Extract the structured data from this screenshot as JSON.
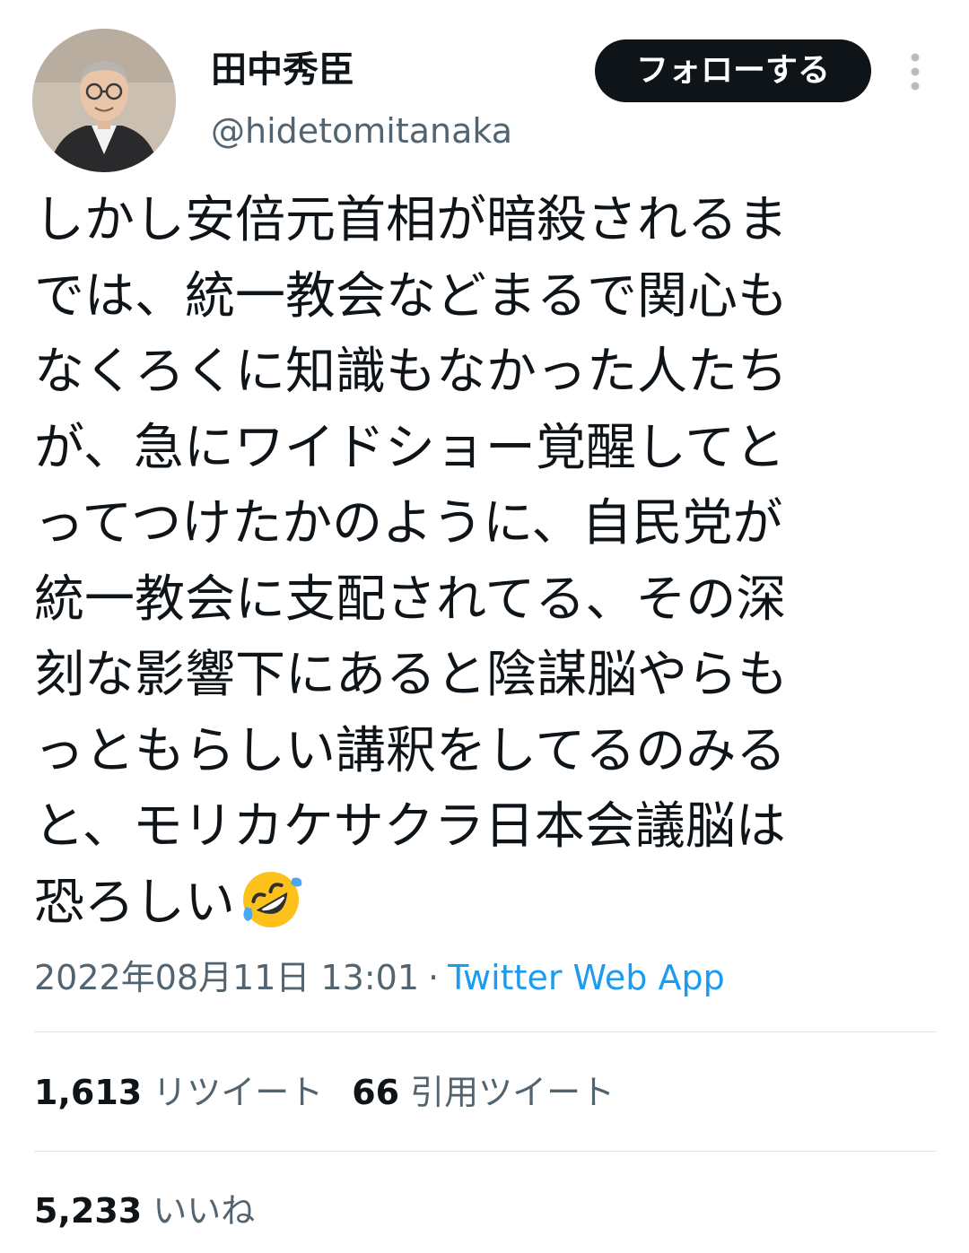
{
  "user": {
    "display_name": "田中秀臣",
    "handle": "@hidetomitanaka",
    "avatar_icon": "profile-photo"
  },
  "follow_button": {
    "label": "フォローする"
  },
  "more_menu": {
    "icon": "more-vertical-icon"
  },
  "tweet": {
    "lines": [
      "しかし安倍元首相が暗殺されるま",
      "では、統一教会などまるで関心も",
      "なくろくに知識もなかった人たち",
      "が、急にワイドショー覚醒してと",
      "ってつけたかのように、自民党が",
      "統一教会に支配されてる、その深",
      "刻な影響下にあると陰謀脳やらも",
      "っともらしい講釈をしてるのみる",
      "と、モリカケサクラ日本会議脳は",
      "恐ろしい"
    ],
    "emoji": "rolling-on-the-floor-laughing-emoji"
  },
  "meta": {
    "timestamp": "2022年08月11日 13:01",
    "separator": "·",
    "source": "Twitter Web App"
  },
  "stats": {
    "retweets": {
      "count": "1,613",
      "label": "リツイート"
    },
    "quotes": {
      "count": "66",
      "label": "引用ツイート"
    },
    "likes": {
      "count": "5,233",
      "label": "いいね"
    }
  },
  "colors": {
    "text": "#0f1419",
    "secondary": "#536471",
    "link": "#1d9bf0",
    "button_bg": "#0f1419",
    "divider": "#e1e6ea"
  }
}
